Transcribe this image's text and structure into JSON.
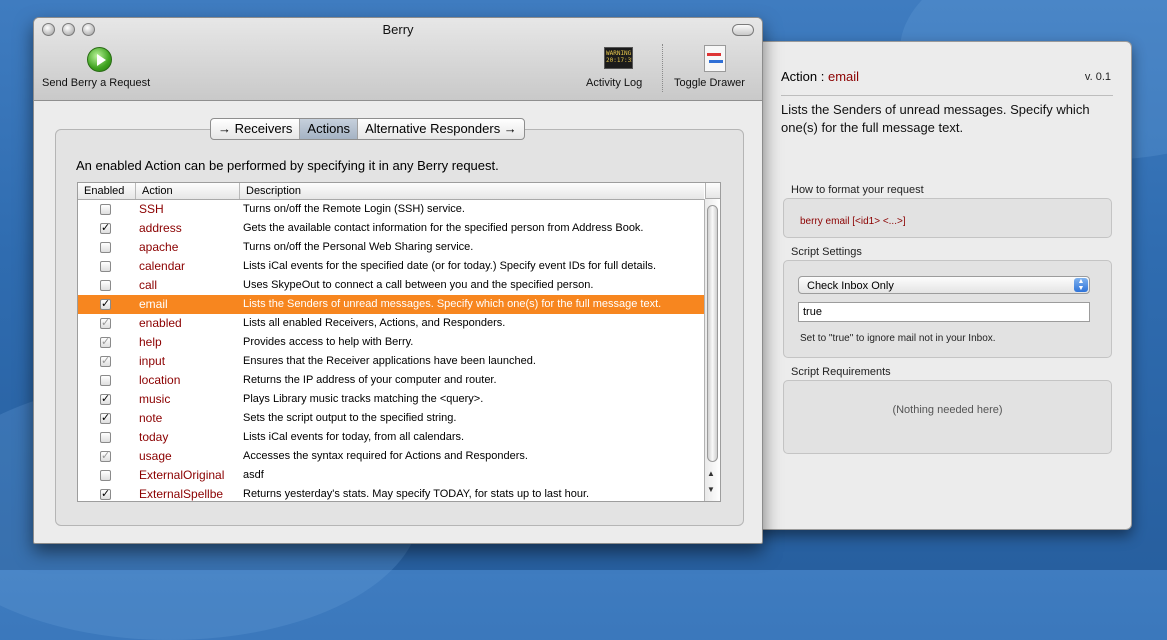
{
  "window": {
    "title": "Berry",
    "toolbar": {
      "send_label": "Send Berry a Request",
      "activity_label": "Activity Log",
      "toggle_label": "Toggle Drawer",
      "activity_icon_text": "WARNING 20:17:35"
    }
  },
  "tabs": [
    "→ Receivers",
    "Actions",
    "Alternative Responders →"
  ],
  "selected_tab": "Actions",
  "intro_text": "An enabled Action can be performed by specifying it in any Berry request.",
  "table": {
    "headers": [
      "Enabled",
      "Action",
      "Description"
    ],
    "rows": [
      {
        "enabled": "",
        "action": "SSH",
        "description": "Turns on/off the Remote Login (SSH) service."
      },
      {
        "enabled": "✓",
        "action": "address",
        "description": "Gets the available contact information for the specified person from Address Book."
      },
      {
        "enabled": "",
        "action": "apache",
        "description": "Turns on/off the Personal Web Sharing service."
      },
      {
        "enabled": "",
        "action": "calendar",
        "description": "Lists iCal events for the specified date (or for today.) Specify event IDs for full details."
      },
      {
        "enabled": "",
        "action": "call",
        "description": "Uses SkypeOut to connect a call between you and the specified person."
      },
      {
        "enabled": "✓",
        "action": "email",
        "description": "Lists the Senders of unread messages. Specify which one(s) for the full message text."
      },
      {
        "enabled": "✓",
        "action": "enabled",
        "description": "Lists all enabled Receivers, Actions, and Responders."
      },
      {
        "enabled": "✓",
        "action": "help",
        "description": "Provides access to help with Berry."
      },
      {
        "enabled": "✓",
        "action": "input",
        "description": "Ensures that the Receiver applications have been launched."
      },
      {
        "enabled": "",
        "action": "location",
        "description": "Returns the IP address of your computer and router."
      },
      {
        "enabled": "✓",
        "action": "music",
        "description": "Plays Library music tracks matching the <query>."
      },
      {
        "enabled": "✓",
        "action": "note",
        "description": "Sets the script output to the specified string."
      },
      {
        "enabled": "",
        "action": "today",
        "description": "Lists iCal events for today, from all calendars."
      },
      {
        "enabled": "✓",
        "action": "usage",
        "description": "Accesses the syntax required for Actions and Responders."
      },
      {
        "enabled": "",
        "action": "ExternalOriginal",
        "description": "asdf"
      },
      {
        "enabled": "✓",
        "action": "ExternalSpellbe",
        "description": "Returns yesterday's stats. May specify TODAY, for stats up to last hour."
      }
    ],
    "selected_row": 5,
    "dim_checks": [
      6,
      7,
      8,
      13
    ]
  },
  "drawer": {
    "action_prefix": "Action  :",
    "action_name": "email",
    "version": "v. 0.1",
    "description": "Lists the Senders of unread messages. Specify which one(s) for the full message text.",
    "format_label": "How to format your request",
    "format_syntax": "berry email [<id1> <...>]",
    "settings_label": "Script Settings",
    "settings_popup": "Check Inbox Only",
    "settings_value": "true",
    "settings_hint": "Set to \"true\" to ignore mail not in your Inbox.",
    "requirements_label": "Script Requirements",
    "requirements_text": "(Nothing needed here)"
  },
  "colors": {
    "selection": "#f7861f",
    "action_text": "#8b0000",
    "desktop": "#2f6cb0"
  }
}
